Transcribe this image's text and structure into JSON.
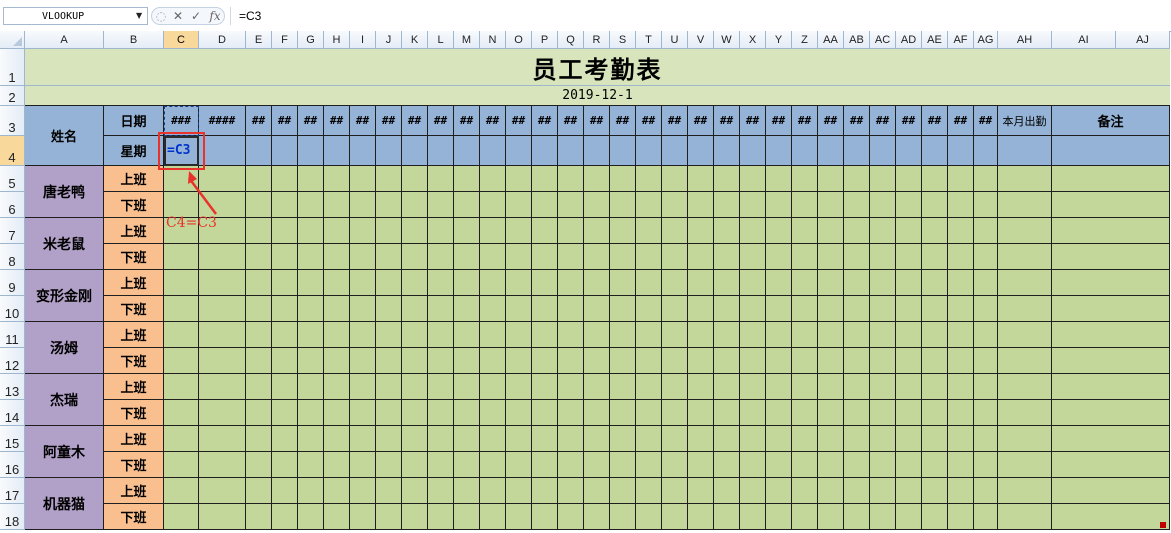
{
  "formula_bar": {
    "name_box": "VLOOKUP",
    "cancel_glyph": "✕",
    "confirm_glyph": "✓",
    "fx_glyph": "fx",
    "formula": "=C3"
  },
  "columns": [
    "A",
    "B",
    "C",
    "D",
    "E",
    "F",
    "G",
    "H",
    "I",
    "J",
    "K",
    "L",
    "M",
    "N",
    "O",
    "P",
    "Q",
    "R",
    "S",
    "T",
    "U",
    "V",
    "W",
    "X",
    "Y",
    "Z",
    "AA",
    "AB",
    "AC",
    "AD",
    "AE",
    "AF",
    "AG",
    "AH",
    "AI",
    "AJ"
  ],
  "active_column": "C",
  "rows": [
    "1",
    "2",
    "3",
    "4",
    "5",
    "6",
    "7",
    "8",
    "9",
    "10",
    "11",
    "12",
    "13",
    "14",
    "15",
    "16",
    "17",
    "18"
  ],
  "active_row": "4",
  "sheet": {
    "title": "员工考勤表",
    "date": "2019-12-1",
    "name_header": "姓名",
    "date_label": "日期",
    "weekday_label": "星期",
    "c3_display": "###",
    "d3_display": "####",
    "overflow_display": "##",
    "month_attendance_header": "本月出勤",
    "remarks_header": "备注",
    "c4_formula": "=C3",
    "employees": [
      {
        "name": "唐老鸭",
        "shift_on": "上班",
        "shift_off": "下班"
      },
      {
        "name": "米老鼠",
        "shift_on": "上班",
        "shift_off": "下班"
      },
      {
        "name": "变形金刚",
        "shift_on": "上班",
        "shift_off": "下班"
      },
      {
        "name": "汤姆",
        "shift_on": "上班",
        "shift_off": "下班"
      },
      {
        "name": "杰瑞",
        "shift_on": "上班",
        "shift_off": "下班"
      },
      {
        "name": "阿童木",
        "shift_on": "上班",
        "shift_off": "下班"
      },
      {
        "name": "机器猫",
        "shift_on": "上班",
        "shift_off": "下班"
      }
    ]
  },
  "annotation": {
    "label": "C4=C3",
    "color": "#e8322b"
  },
  "colors": {
    "title_bg": "#d7e4bc",
    "header_bg": "#95b3d7",
    "name_bg": "#b1a0c7",
    "shift_bg": "#fabf8f",
    "body_bg": "#c4d79b"
  }
}
